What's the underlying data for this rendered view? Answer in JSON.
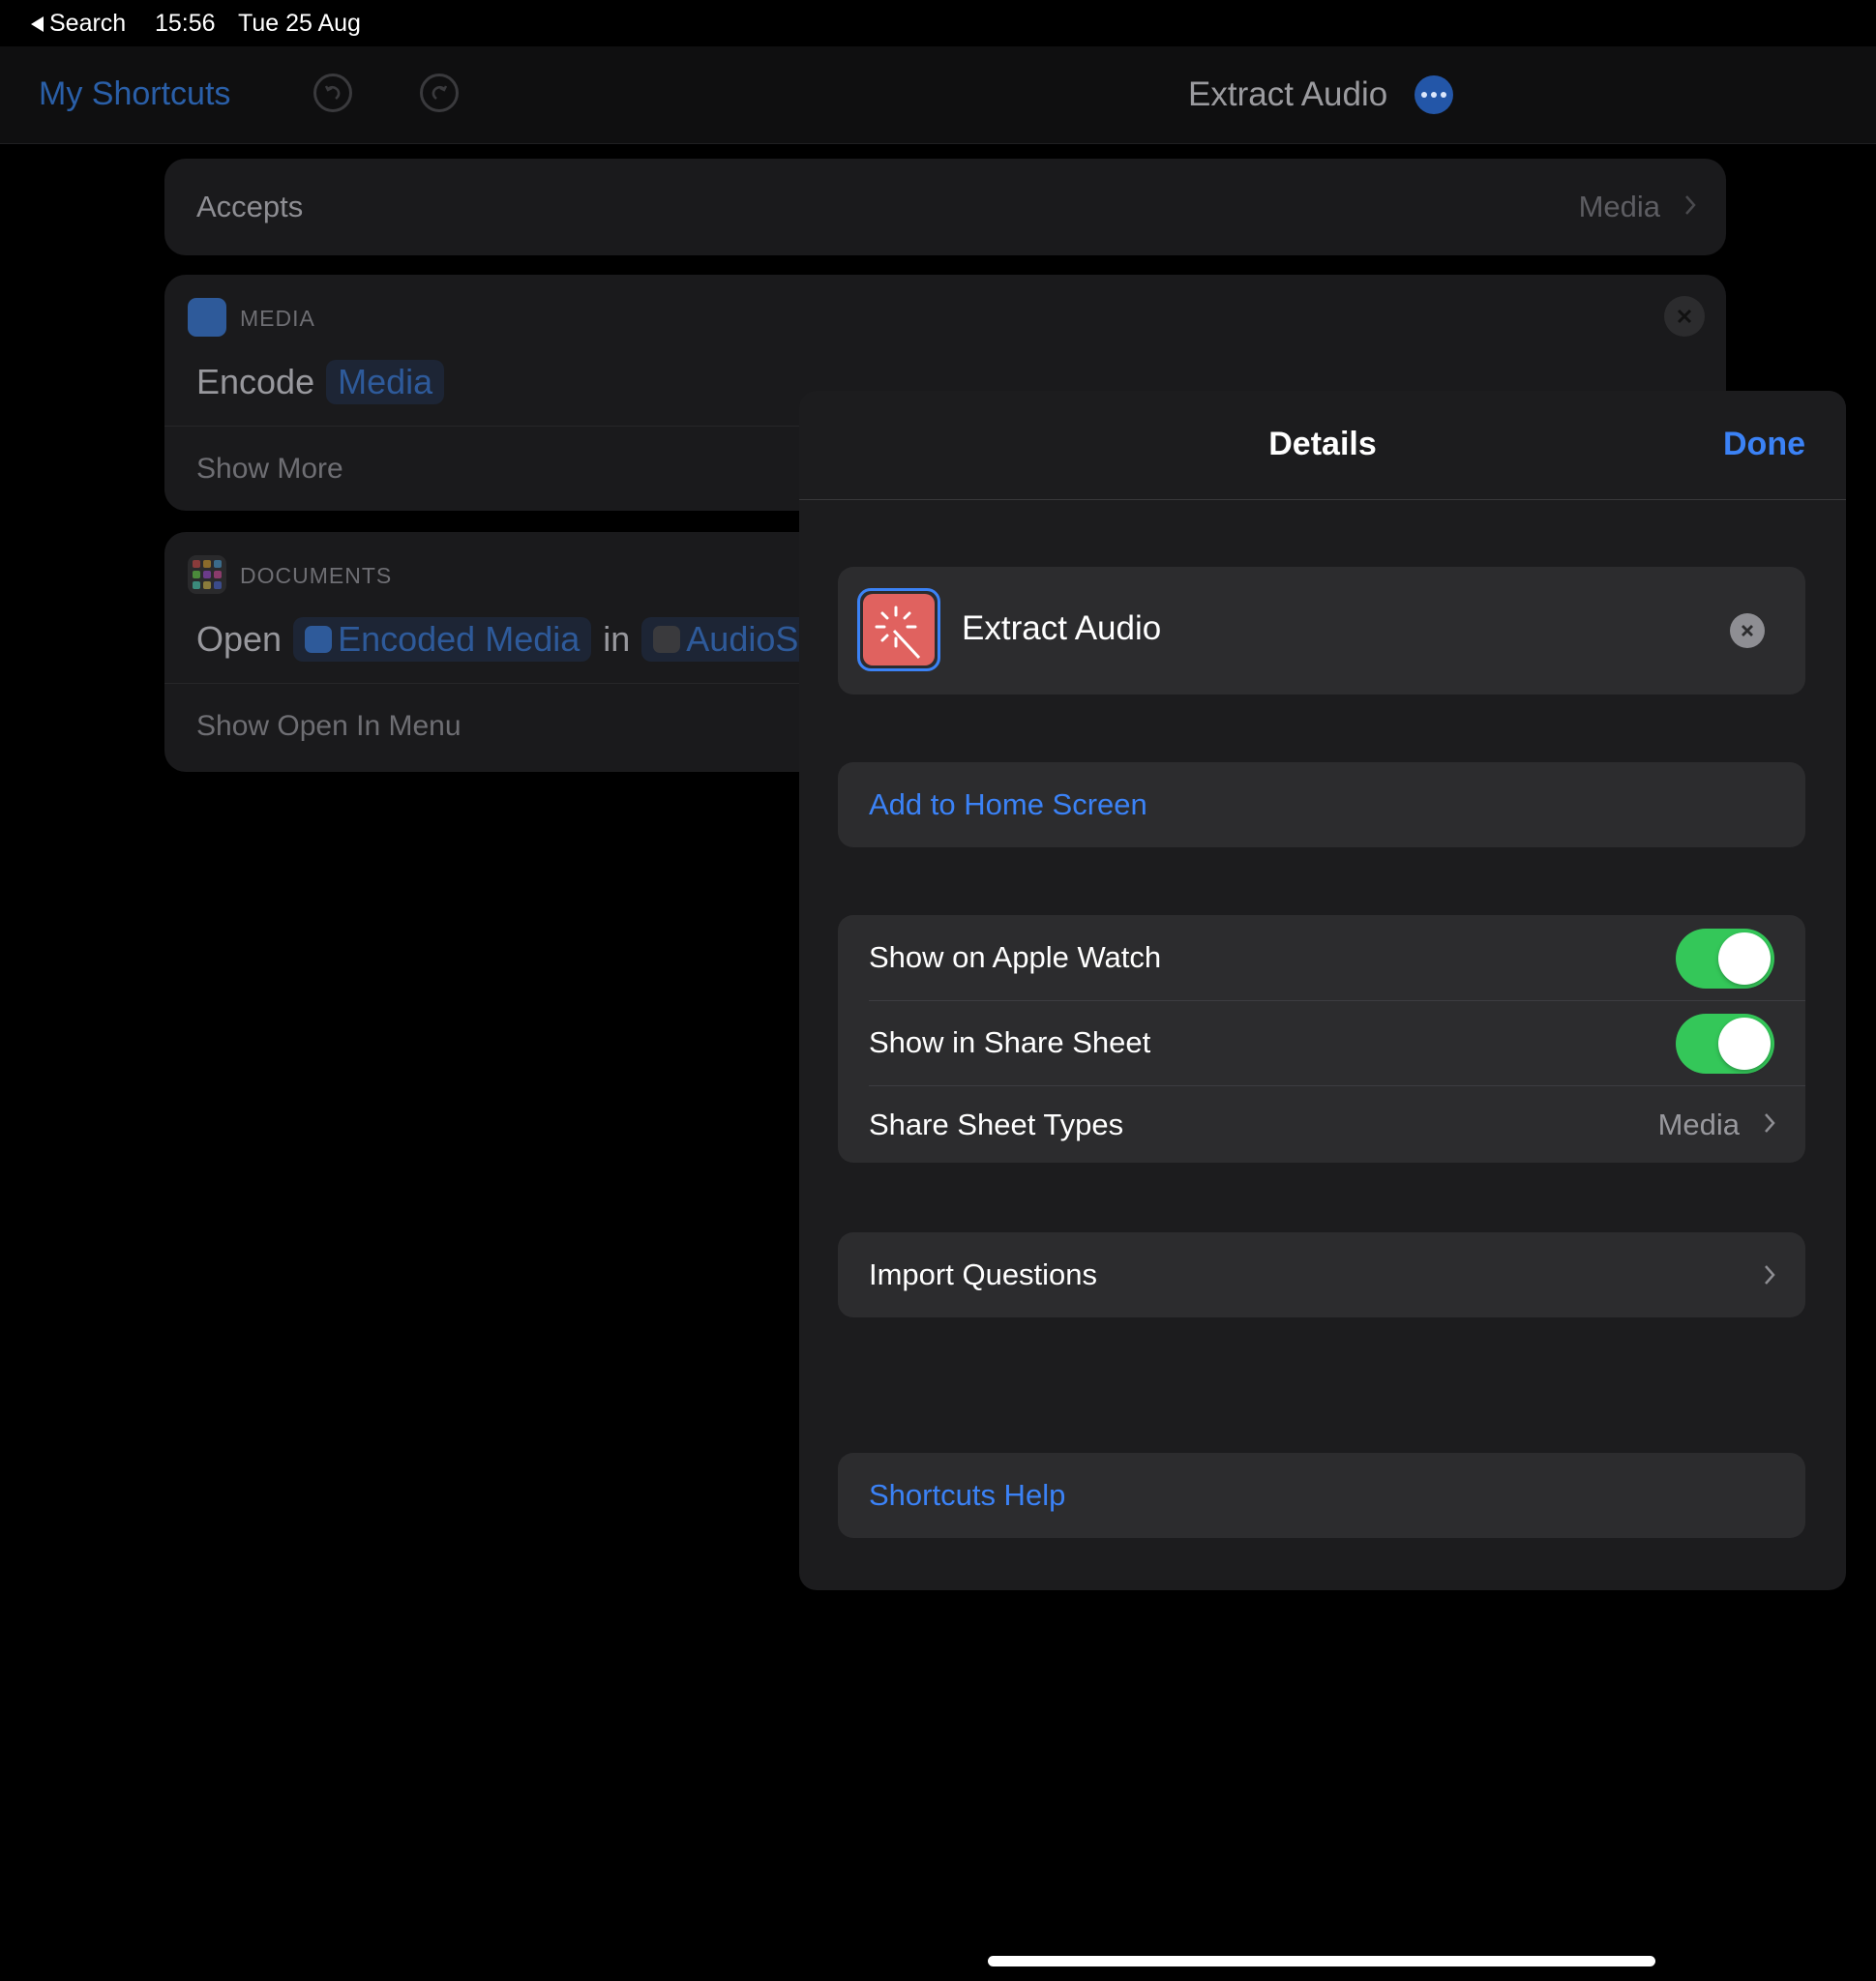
{
  "status_bar": {
    "back_label": "Search",
    "time": "15:56",
    "date": "Tue 25 Aug"
  },
  "nav": {
    "back_label": "My Shortcuts",
    "title": "Extract Audio"
  },
  "editor": {
    "accepts": {
      "label": "Accepts",
      "value": "Media"
    },
    "media_action": {
      "category": "MEDIA",
      "verb": "Encode",
      "token": "Media",
      "footer": "Show More"
    },
    "docs_action": {
      "category": "DOCUMENTS",
      "verb": "Open",
      "token1": "Encoded Media",
      "connector": "in",
      "token2": "AudioS",
      "footer": "Show Open In Menu"
    }
  },
  "details": {
    "title": "Details",
    "done_label": "Done",
    "shortcut_name": "Extract Audio",
    "add_home": "Add to Home Screen",
    "toggles": [
      {
        "label": "Show on Apple Watch",
        "on": true
      },
      {
        "label": "Show in Share Sheet",
        "on": true
      }
    ],
    "share_types": {
      "label": "Share Sheet Types",
      "value": "Media"
    },
    "import_questions": "Import Questions",
    "help": "Shortcuts Help"
  },
  "colors": {
    "accent": "#3b82f6",
    "toggle_on": "#34c759",
    "icon_bg": "#e0625f"
  }
}
